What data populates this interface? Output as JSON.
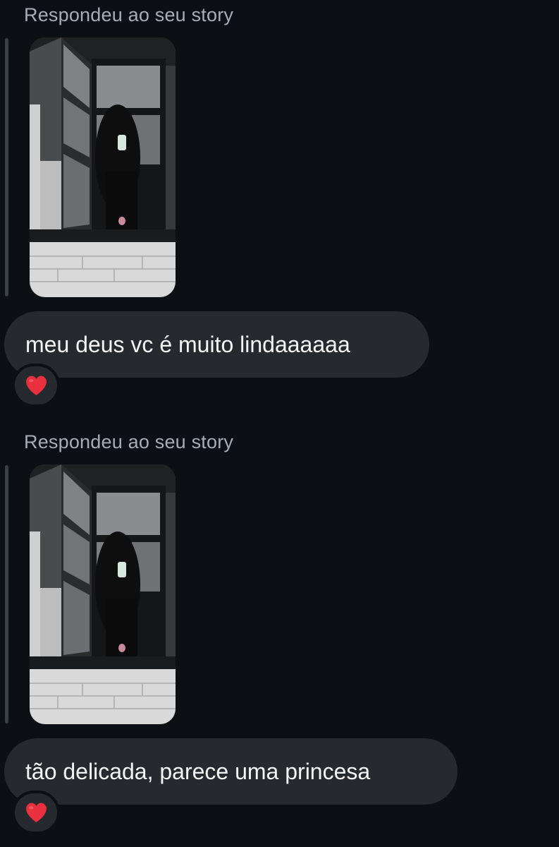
{
  "colors": {
    "background": "#0c1014",
    "bubble": "#262a2f",
    "label": "#a8adb3",
    "heart": "#e8303f"
  },
  "messages": [
    {
      "reply_label": "Respondeu ao seu story",
      "text": "meu deus vc é muito lindaaaaaa",
      "reaction_icon": "heart-icon"
    },
    {
      "reply_label": "Respondeu ao seu story",
      "text": "tão delicada, parece uma princesa",
      "reaction_icon": "heart-icon"
    }
  ]
}
